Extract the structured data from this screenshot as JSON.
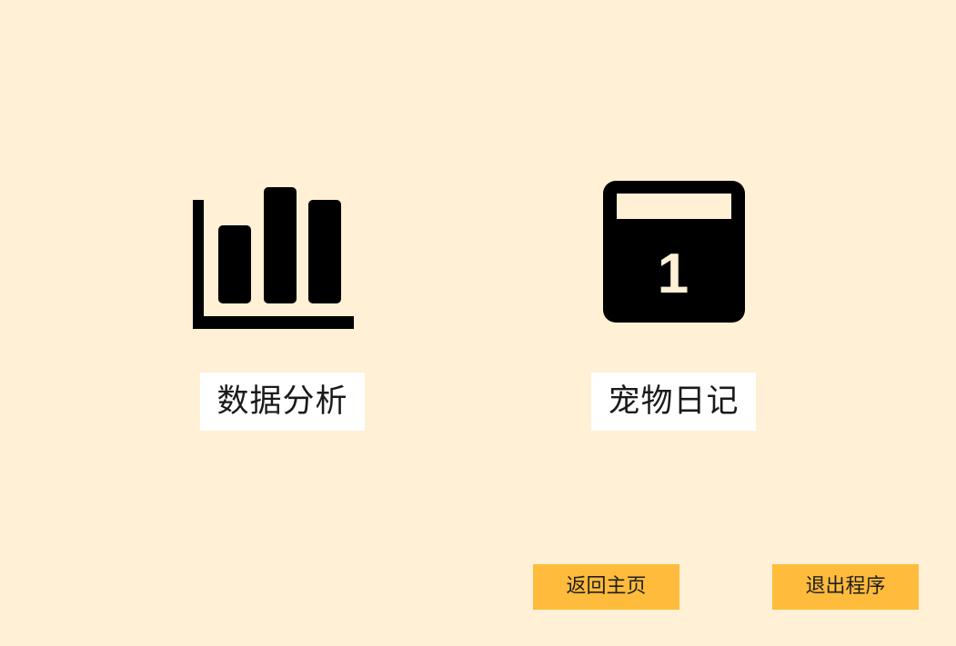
{
  "colors": {
    "background": "#FFF0D6",
    "label_box": "#FFFFFF",
    "button": "#FFBB3B",
    "icon": "#000000"
  },
  "tiles": [
    {
      "icon": "bar-chart-icon",
      "label": "数据分析"
    },
    {
      "icon": "calendar-icon",
      "label": "宠物日记",
      "calendar_day": "1"
    }
  ],
  "buttons": {
    "home": "返回主页",
    "exit": "退出程序"
  }
}
